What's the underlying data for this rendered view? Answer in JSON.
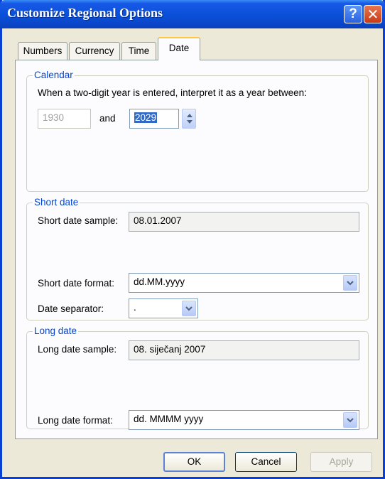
{
  "window": {
    "title": "Customize Regional Options",
    "help_glyph": "?",
    "close_glyph": "✕"
  },
  "tabs": [
    {
      "label": "Numbers",
      "active": false
    },
    {
      "label": "Currency",
      "active": false
    },
    {
      "label": "Time",
      "active": false
    },
    {
      "label": "Date",
      "active": true
    }
  ],
  "calendar": {
    "group_label": "Calendar",
    "description": "When a two-digit year is entered, interpret it as a year between:",
    "start_year": "1930",
    "and_label": "and",
    "end_year": "2029"
  },
  "short_date": {
    "group_label": "Short date",
    "sample_label": "Short date sample:",
    "sample_value": "08.01.2007",
    "format_label": "Short date format:",
    "format_value": "dd.MM.yyyy",
    "separator_label": "Date separator:",
    "separator_value": "."
  },
  "long_date": {
    "group_label": "Long date",
    "sample_label": "Long date sample:",
    "sample_value": "08. siječanj 2007",
    "format_label": "Long date format:",
    "format_value": "dd. MMMM yyyy"
  },
  "buttons": {
    "ok": "OK",
    "cancel": "Cancel",
    "apply": "Apply"
  },
  "colors": {
    "title_bar": "#0a4fd8",
    "group_title": "#0046d5",
    "active_tab_accent": "#ffc83c"
  }
}
